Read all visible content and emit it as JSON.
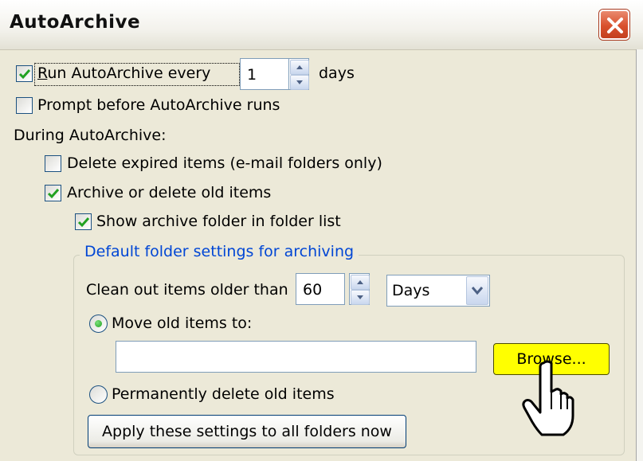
{
  "window": {
    "title": "AutoArchive",
    "close_icon": "close-x-icon"
  },
  "options": {
    "run_autoarchive": {
      "label": "Run AutoArchive every",
      "checked": true
    },
    "run_days_value": "1",
    "days_unit": "days",
    "prompt_before": {
      "label": "Prompt before AutoArchive runs",
      "checked": false
    },
    "during_label": "During AutoArchive:",
    "delete_expired": {
      "label": "Delete expired items (e-mail folders only)",
      "checked": false
    },
    "archive_old": {
      "label": "Archive or delete old items",
      "checked": true
    },
    "show_archive_folder": {
      "label": "Show archive folder in folder list",
      "checked": true
    }
  },
  "defaults_group": {
    "title": "Default folder settings for archiving",
    "clean_out_label": "Clean out items older than",
    "clean_out_value": "60",
    "period_unit": "Days",
    "move_old": {
      "label": "Move old items to:",
      "selected": true
    },
    "move_path": "",
    "browse_label": "Browse...",
    "perm_delete": {
      "label": "Permanently delete old items",
      "selected": false
    },
    "apply_label": "Apply these settings to all folders now"
  },
  "colors": {
    "dialog_bg": "#ece9d8",
    "group_title": "#0046d5",
    "browse_highlight": "#ffff00",
    "check_mark": "#21a121"
  },
  "icons": [
    "close-x-icon",
    "checkmark-icon",
    "spin-up-icon",
    "spin-down-icon",
    "dropdown-arrow-icon",
    "hand-pointer-icon"
  ]
}
